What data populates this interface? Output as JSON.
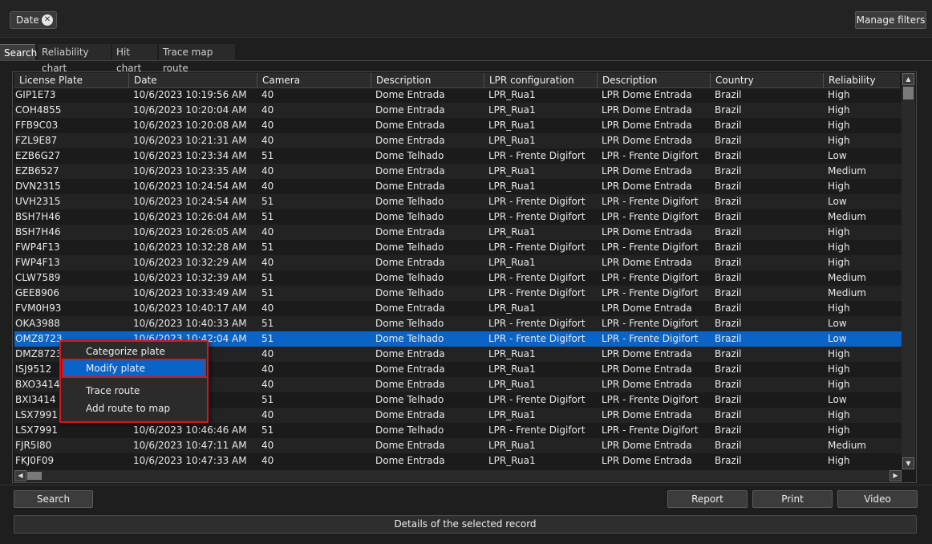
{
  "filters": {
    "chip_label": "Date",
    "chip_close": "✕",
    "manage_label": "Manage filters"
  },
  "tabs": [
    {
      "label": "Search",
      "active": true
    },
    {
      "label": "Reliability chart"
    },
    {
      "label": "Hit chart"
    },
    {
      "label": "Trace map route"
    }
  ],
  "columns": [
    "License Plate",
    "Date",
    "Camera",
    "Description",
    "LPR configuration",
    "Description",
    "Country",
    "Reliability"
  ],
  "rows": [
    [
      "GIP1E73",
      "10/6/2023 10:19:56 AM",
      "40",
      "Dome Entrada",
      "LPR_Rua1",
      "LPR Dome Entrada",
      "Brazil",
      "High"
    ],
    [
      "COH4855",
      "10/6/2023 10:20:04 AM",
      "40",
      "Dome Entrada",
      "LPR_Rua1",
      "LPR Dome Entrada",
      "Brazil",
      "High"
    ],
    [
      "FFB9C03",
      "10/6/2023 10:20:08 AM",
      "40",
      "Dome Entrada",
      "LPR_Rua1",
      "LPR Dome Entrada",
      "Brazil",
      "High"
    ],
    [
      "FZL9E87",
      "10/6/2023 10:21:31 AM",
      "40",
      "Dome Entrada",
      "LPR_Rua1",
      "LPR Dome Entrada",
      "Brazil",
      "High"
    ],
    [
      "EZB6G27",
      "10/6/2023 10:23:34 AM",
      "51",
      "Dome Telhado",
      "LPR - Frente Digifort",
      "LPR - Frente Digifort",
      "Brazil",
      "Low"
    ],
    [
      "EZB6527",
      "10/6/2023 10:23:35 AM",
      "40",
      "Dome Entrada",
      "LPR_Rua1",
      "LPR Dome Entrada",
      "Brazil",
      "Medium"
    ],
    [
      "DVN2315",
      "10/6/2023 10:24:54 AM",
      "40",
      "Dome Entrada",
      "LPR_Rua1",
      "LPR Dome Entrada",
      "Brazil",
      "High"
    ],
    [
      "UVH2315",
      "10/6/2023 10:24:54 AM",
      "51",
      "Dome Telhado",
      "LPR - Frente Digifort",
      "LPR - Frente Digifort",
      "Brazil",
      "Low"
    ],
    [
      "BSH7H46",
      "10/6/2023 10:26:04 AM",
      "51",
      "Dome Telhado",
      "LPR - Frente Digifort",
      "LPR - Frente Digifort",
      "Brazil",
      "Medium"
    ],
    [
      "BSH7H46",
      "10/6/2023 10:26:05 AM",
      "40",
      "Dome Entrada",
      "LPR_Rua1",
      "LPR Dome Entrada",
      "Brazil",
      "High"
    ],
    [
      "FWP4F13",
      "10/6/2023 10:32:28 AM",
      "51",
      "Dome Telhado",
      "LPR - Frente Digifort",
      "LPR - Frente Digifort",
      "Brazil",
      "High"
    ],
    [
      "FWP4F13",
      "10/6/2023 10:32:29 AM",
      "40",
      "Dome Entrada",
      "LPR_Rua1",
      "LPR Dome Entrada",
      "Brazil",
      "High"
    ],
    [
      "CLW7589",
      "10/6/2023 10:32:39 AM",
      "51",
      "Dome Telhado",
      "LPR - Frente Digifort",
      "LPR - Frente Digifort",
      "Brazil",
      "Medium"
    ],
    [
      "GEE8906",
      "10/6/2023 10:33:49 AM",
      "51",
      "Dome Telhado",
      "LPR - Frente Digifort",
      "LPR - Frente Digifort",
      "Brazil",
      "Medium"
    ],
    [
      "FVM0H93",
      "10/6/2023 10:40:17 AM",
      "40",
      "Dome Entrada",
      "LPR_Rua1",
      "LPR Dome Entrada",
      "Brazil",
      "High"
    ],
    [
      "OKA3988",
      "10/6/2023 10:40:33 AM",
      "51",
      "Dome Telhado",
      "LPR - Frente Digifort",
      "LPR - Frente Digifort",
      "Brazil",
      "Low"
    ],
    [
      "OMZ8723",
      "10/6/2023 10:42:04 AM",
      "51",
      "Dome Telhado",
      "LPR - Frente Digifort",
      "LPR - Frente Digifort",
      "Brazil",
      "Low"
    ],
    [
      "DMZ8723",
      "",
      "40",
      "Dome Entrada",
      "LPR_Rua1",
      "LPR Dome Entrada",
      "Brazil",
      "High"
    ],
    [
      "ISJ9512",
      "",
      "40",
      "Dome Entrada",
      "LPR_Rua1",
      "LPR Dome Entrada",
      "Brazil",
      "High"
    ],
    [
      "BXO3414",
      "",
      "40",
      "Dome Entrada",
      "LPR_Rua1",
      "LPR Dome Entrada",
      "Brazil",
      "High"
    ],
    [
      "BXI3414",
      "",
      "51",
      "Dome Telhado",
      "LPR - Frente Digifort",
      "LPR - Frente Digifort",
      "Brazil",
      "Low"
    ],
    [
      "LSX7991",
      "",
      "40",
      "Dome Entrada",
      "LPR_Rua1",
      "LPR Dome Entrada",
      "Brazil",
      "High"
    ],
    [
      "LSX7991",
      "10/6/2023 10:46:46 AM",
      "51",
      "Dome Telhado",
      "LPR - Frente Digifort",
      "LPR - Frente Digifort",
      "Brazil",
      "High"
    ],
    [
      "FJR5I80",
      "10/6/2023 10:47:11 AM",
      "40",
      "Dome Entrada",
      "LPR_Rua1",
      "LPR Dome Entrada",
      "Brazil",
      "Medium"
    ],
    [
      "FKJ0F09",
      "10/6/2023 10:47:33 AM",
      "40",
      "Dome Entrada",
      "LPR_Rua1",
      "LPR Dome Entrada",
      "Brazil",
      "High"
    ]
  ],
  "selected_row": 16,
  "context_menu": {
    "items": [
      {
        "label": "Categorize plate",
        "name": "menu-categorize-plate"
      },
      {
        "label": "Modify plate",
        "name": "menu-modify-plate",
        "highlighted": true
      },
      {
        "label": "Trace route",
        "name": "menu-trace-route"
      },
      {
        "label": "Add route to map",
        "name": "menu-add-route-to-map"
      }
    ]
  },
  "actions": {
    "search_label": "Search",
    "report_label": "Report",
    "print_label": "Print",
    "video_label": "Video"
  },
  "details_label": "Details of the selected record",
  "colors": {
    "selection": "#0a64c8",
    "menu_border": "#d8151b"
  }
}
